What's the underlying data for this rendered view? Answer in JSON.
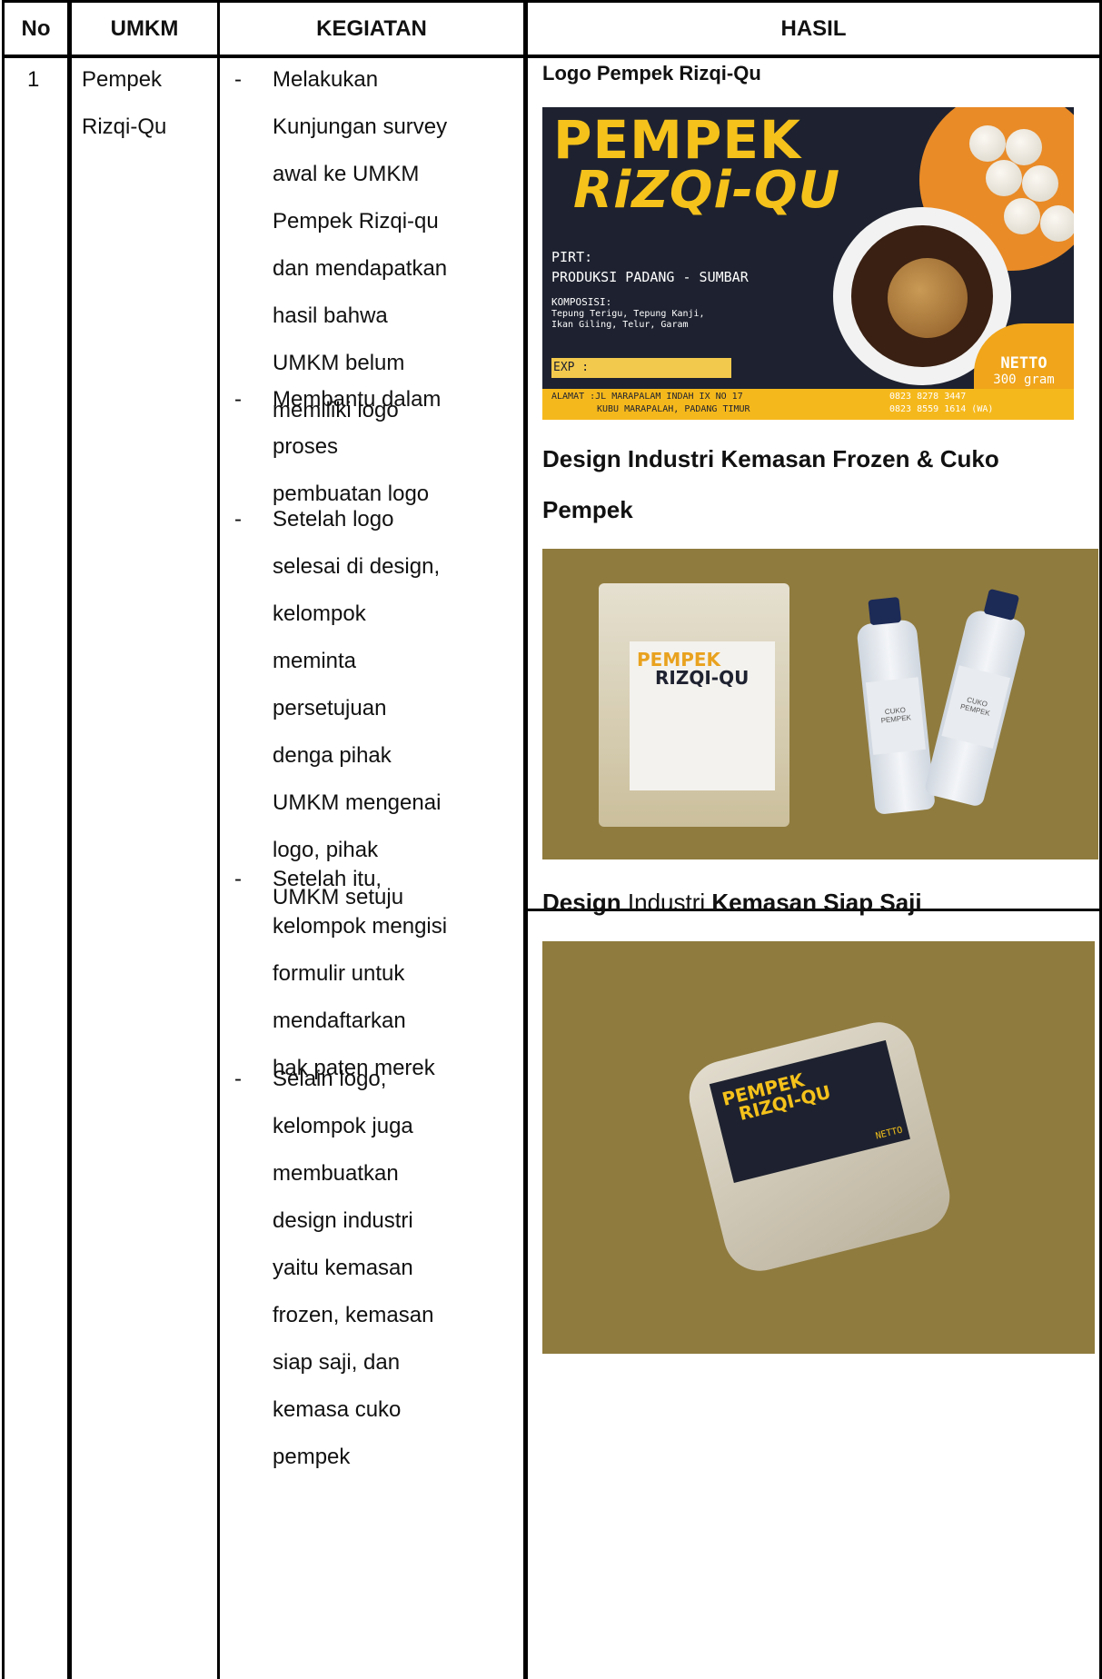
{
  "headers": {
    "no": "No",
    "umkm": "UMKM",
    "kegiatan": "KEGIATAN",
    "hasil": "HASIL"
  },
  "row": {
    "no": "1",
    "umkm_lines": [
      "Pempek",
      "Rizqi-Qu"
    ],
    "kegiatan_items": [
      {
        "dash": "-",
        "lines": [
          "Melakukan",
          "Kunjungan survey",
          "awal ke UMKM",
          "Pempek Rizqi-qu",
          "dan mendapatkan",
          "hasil bahwa",
          "UMKM belum",
          "memiliki logo"
        ]
      },
      {
        "dash": "-",
        "lines": [
          "Membantu dalam",
          "proses",
          "pembuatan logo"
        ]
      },
      {
        "dash": "-",
        "lines": [
          "Setelah logo",
          "selesai di design,",
          "kelompok",
          "meminta",
          "persetujuan",
          "denga pihak",
          "UMKM mengenai",
          "logo, pihak",
          "UMKM setuju"
        ]
      },
      {
        "dash": "-",
        "lines": [
          "Setelah itu,",
          "kelompok mengisi",
          "formulir untuk",
          "mendaftarkan",
          "hak paten merek"
        ]
      },
      {
        "dash": "-",
        "lines": [
          "Selain logo,",
          "kelompok juga",
          "membuatkan",
          "design industri",
          "yaitu kemasan",
          "frozen, kemasan",
          "siap saji, dan",
          "kemasa cuko",
          "pempek"
        ]
      }
    ]
  },
  "hasil": {
    "caption1": "Logo Pempek Rizqi-Qu",
    "caption2_line1": "Design Industri Kemasan Frozen & Cuko",
    "caption2_line2": "Pempek",
    "caption3_part1": "Design",
    "caption3_part2": " Industri ",
    "caption3_part3": "Kemasan Siap Saji"
  },
  "logo_image": {
    "title_line1": "PEMPEK",
    "title_line2": "RiZQi-QU",
    "pirt": "PIRT:",
    "produksi": "PRODUKSI PADANG - SUMBAR",
    "komposisi_label": "KOMPOSISI:",
    "komposisi_line1": "Tepung Terigu, Tepung Kanji,",
    "komposisi_line2": "Ikan Giling, Telur, Garam",
    "exp": "EXP :",
    "netto": "NETTO",
    "netto_amount": "300 gram",
    "alamat_line1": "ALAMAT :JL MARAPALAM INDAH IX NO 17",
    "alamat_line2": "KUBU MARAPALAH, PADANG TIMUR",
    "phone1": "0823 8278 3447",
    "phone2": "0823 8559 1614 (WA)"
  },
  "pack_image": {
    "label_title_1": "PEMPEK",
    "label_title_2": "RIZQI-QU",
    "bottle_text": "CUKO PEMPEK"
  },
  "box_image": {
    "label_title_1": "PEMPEK",
    "label_title_2": "RIZQI-QU",
    "netto": "NETTO"
  }
}
